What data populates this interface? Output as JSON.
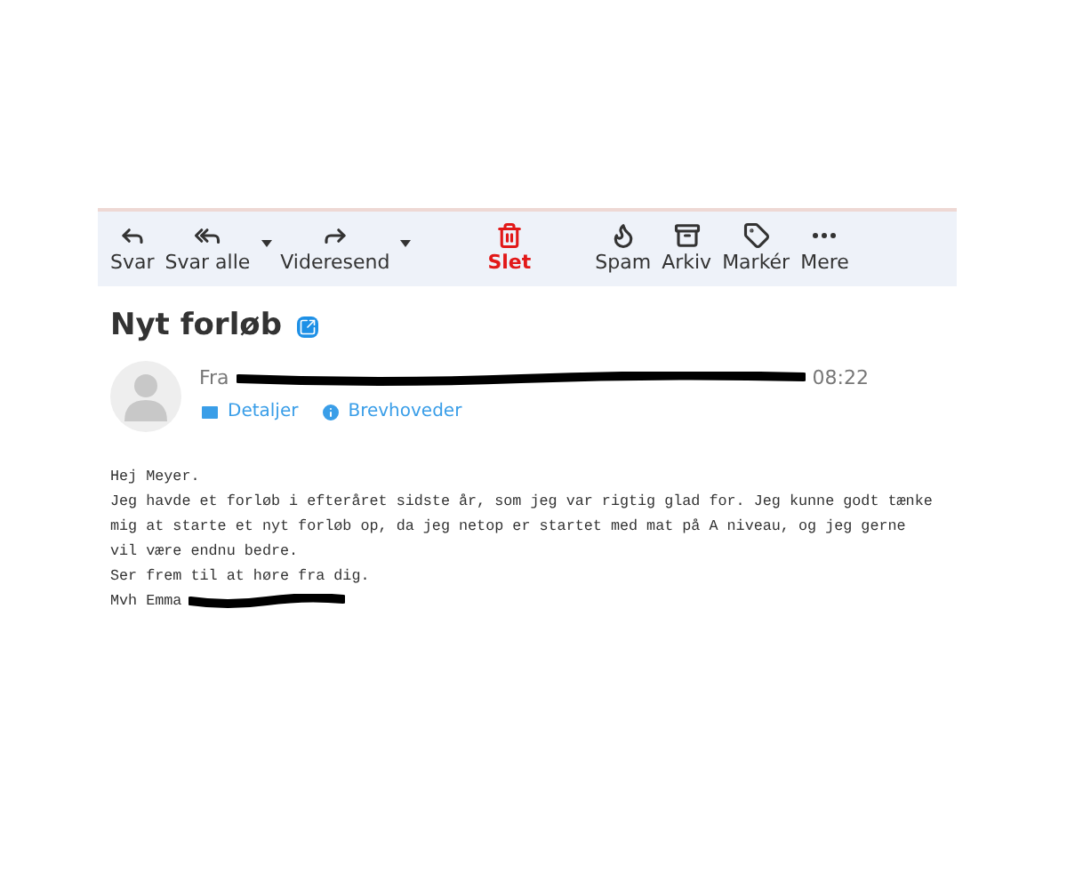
{
  "toolbar": [
    {
      "label": "Svar",
      "dropdown": false,
      "danger": false
    },
    {
      "label": "Svar alle",
      "dropdown": true,
      "danger": false
    },
    {
      "label": "Videresend",
      "dropdown": true,
      "danger": false
    },
    {
      "label": "Slet",
      "dropdown": false,
      "danger": true
    },
    {
      "label": "Spam",
      "dropdown": false,
      "danger": false
    },
    {
      "label": "Arkiv",
      "dropdown": false,
      "danger": false
    },
    {
      "label": "Markér",
      "dropdown": false,
      "danger": false
    },
    {
      "label": "Mere",
      "dropdown": false,
      "danger": false
    }
  ],
  "message": {
    "subject": "Nyt forløb",
    "from_label": "Fra",
    "time": "08:22",
    "links": [
      "Detaljer",
      "Brevhoveder"
    ],
    "body": [
      "Hej Meyer.",
      "Jeg havde et forløb i efteråret sidste år, som jeg var rigtig glad for. Jeg kunne godt tænke",
      "mig at starte et nyt forløb op, da jeg netop er startet med mat på A niveau, og jeg gerne",
      "vil være endnu bedre.",
      "Ser frem til at høre fra dig."
    ],
    "signature": "Mvh Emma"
  }
}
